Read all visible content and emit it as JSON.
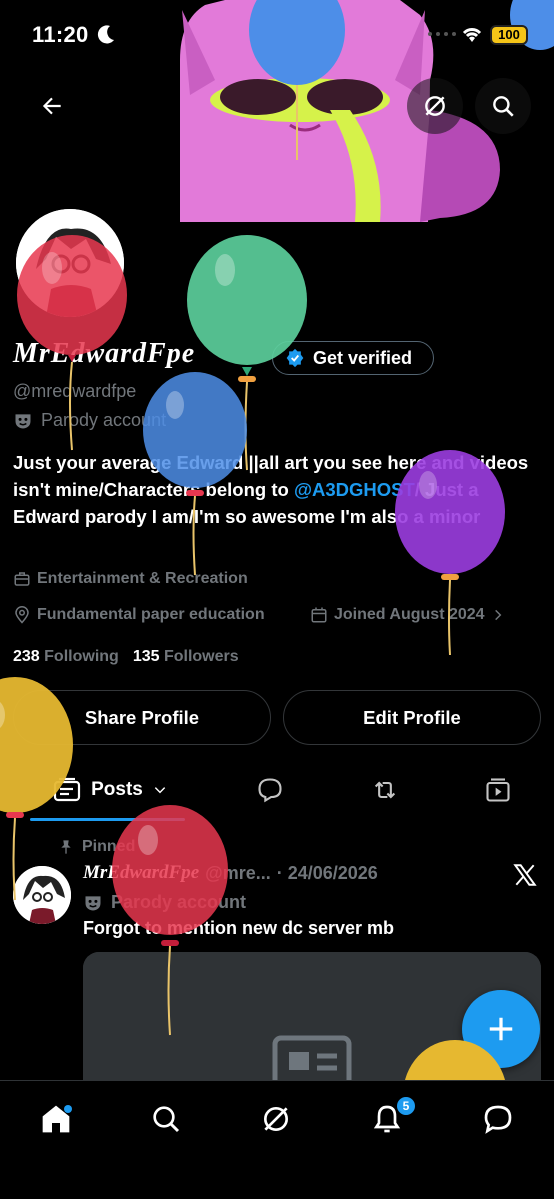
{
  "status_bar": {
    "time": "11:20",
    "battery": "100"
  },
  "profile": {
    "display_name": "MrEdwardFpe",
    "verify_label": "Get verified",
    "handle": "@mredwardfpe",
    "parody_label": "Parody account",
    "bio_part1": "Just your average Edward ||all art you see here and videos isn't mine/Characters belong to ",
    "bio_mention": "@A3DGHOST",
    "bio_part2": "/ Just a Edward parody I am/I'm so awesome I'm also a minor",
    "category": "Entertainment & Recreation",
    "location": "Fundamental paper education",
    "joined": "Joined August 2024",
    "following_count": "238",
    "following_label": "Following",
    "followers_count": "135",
    "followers_label": "Followers",
    "share_label": "Share Profile",
    "edit_label": "Edit Profile"
  },
  "tabs": {
    "posts_label": "Posts"
  },
  "post": {
    "pinned_label": "Pinned",
    "name": "MrEdwardFpe",
    "handle": "@mre...",
    "date": "· 24/06/2026",
    "parody_label": "Parody account",
    "text": "Forgot to mention new dc server mb"
  },
  "nav": {
    "notif_count": "5"
  },
  "colors": {
    "accent": "#1d9bf0",
    "background": "#000000",
    "muted": "#71767b"
  },
  "icons": [
    "back-arrow-icon",
    "grok-icon",
    "search-icon",
    "verified-badge-icon",
    "parody-mask-icon",
    "briefcase-icon",
    "location-pin-icon",
    "calendar-icon",
    "chevron-right-icon",
    "posts-icon",
    "chevron-down-icon",
    "reply-icon",
    "repost-icon",
    "media-icon",
    "pin-icon",
    "x-logo-icon",
    "plus-icon",
    "home-icon",
    "bell-icon",
    "message-icon"
  ]
}
